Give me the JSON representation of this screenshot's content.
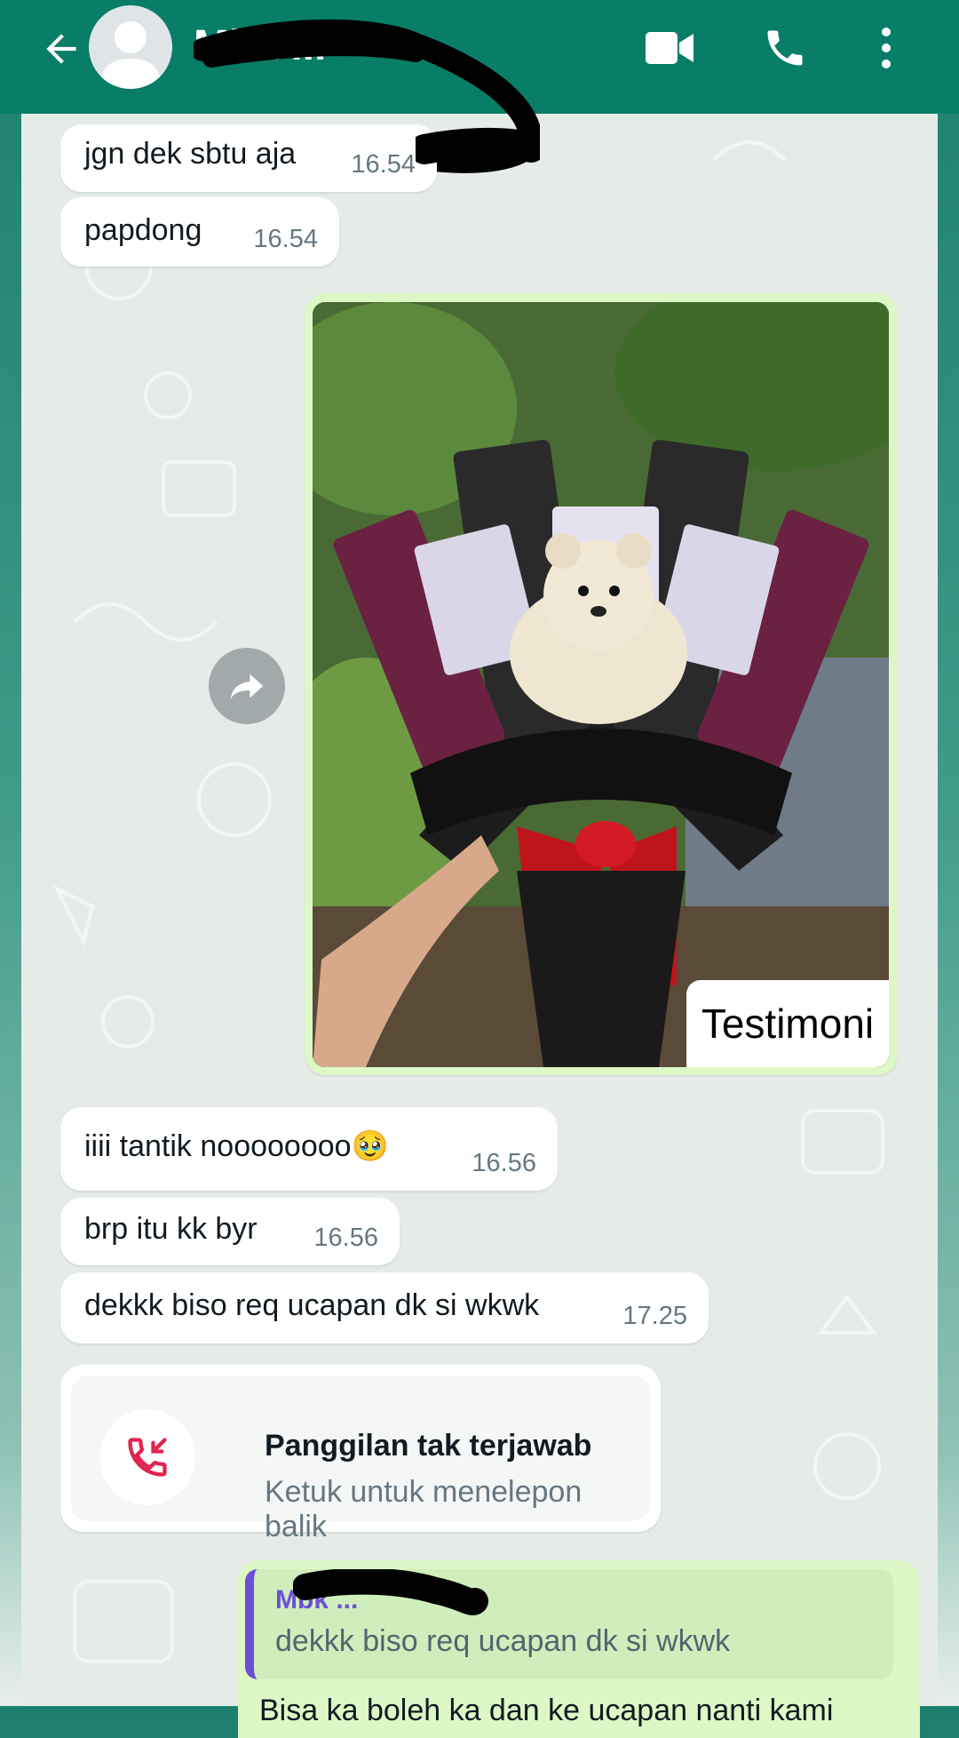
{
  "header": {
    "contact_name": "Mbk ...",
    "icons": [
      "back-arrow-icon",
      "avatar-icon",
      "video-call-icon",
      "voice-call-icon",
      "more-vert-icon"
    ]
  },
  "messages": [
    {
      "text": "jgn dek sbtu aja",
      "time": "16.54"
    },
    {
      "text": "papdong",
      "time": "16.54"
    },
    {
      "text": "iiii tantik noooooooo🥹",
      "time": "16.56"
    },
    {
      "text": "brp itu kk byr",
      "time": "16.56"
    },
    {
      "text": "dekkk biso req ucapan dk si wkwk",
      "time": "17.25"
    }
  ],
  "media": {
    "caption": "Testimoni",
    "forward_icon": "forward-icon"
  },
  "missed_call": {
    "title": "Panggilan tak terjawab",
    "subtitle": "Ketuk untuk menelepon balik"
  },
  "reply": {
    "quoted_name": "Mbk ...",
    "quoted_text": "dekkk biso req ucapan dk si wkwk",
    "body_partial": "Bisa ka boleh ka dan ke ucapan nanti kami"
  },
  "colors": {
    "header": "#087d68",
    "chat_bg": "#e5ece8",
    "outgoing": "#dcf8c6",
    "incoming": "#ffffff",
    "quote_bar": "#6b50d6",
    "missed_call_red": "#e0244f"
  }
}
